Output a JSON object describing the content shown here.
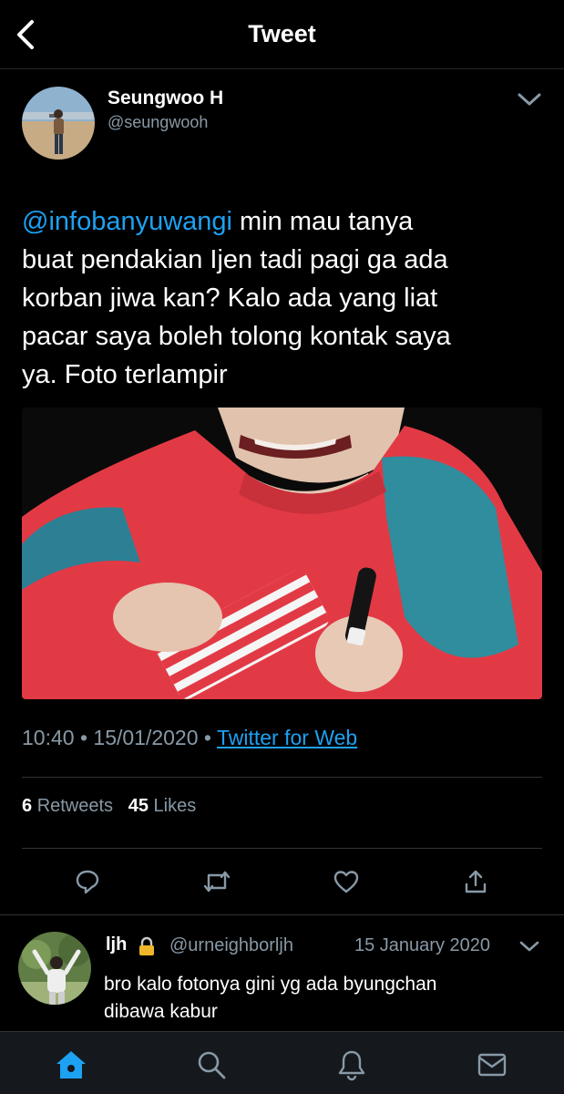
{
  "header": {
    "title": "Tweet",
    "back_icon": "chevron-left-icon"
  },
  "tweet": {
    "author": {
      "name": "Seungwoo H",
      "handle": "@seungwooh"
    },
    "mention": "@infobanyuwangi",
    "text_line1_rest": "min mau tanya",
    "text_line2": "buat pendakian Ijen tadi pagi ga ada",
    "text_line3": "korban jiwa kan? Kalo ada yang liat",
    "text_line4": "pacar saya boleh tolong kontak saya",
    "text_line5": "ya. Foto terlampir",
    "time": "10:40",
    "date": "15/01/2020",
    "separator": "•",
    "source": "Twitter for Web",
    "retweet_count": "6",
    "retweet_label": "Retweets",
    "like_count": "45",
    "like_label": "Likes"
  },
  "actions": [
    "reply-icon",
    "retweet-icon",
    "like-icon",
    "share-icon"
  ],
  "reply": {
    "name": "ljh",
    "handle": "@urneighborljh",
    "date": "15 January 2020",
    "text_line1": "bro kalo fotonya gini yg ada byungchan",
    "text_line2": "dibawa kabur"
  },
  "tabbar": [
    "home-icon",
    "search-icon",
    "notifications-icon",
    "messages-icon"
  ],
  "colors": {
    "accent": "#1da1f2",
    "secondary_text": "#8899a6",
    "background": "#000000",
    "tabbar": "#15181c"
  }
}
